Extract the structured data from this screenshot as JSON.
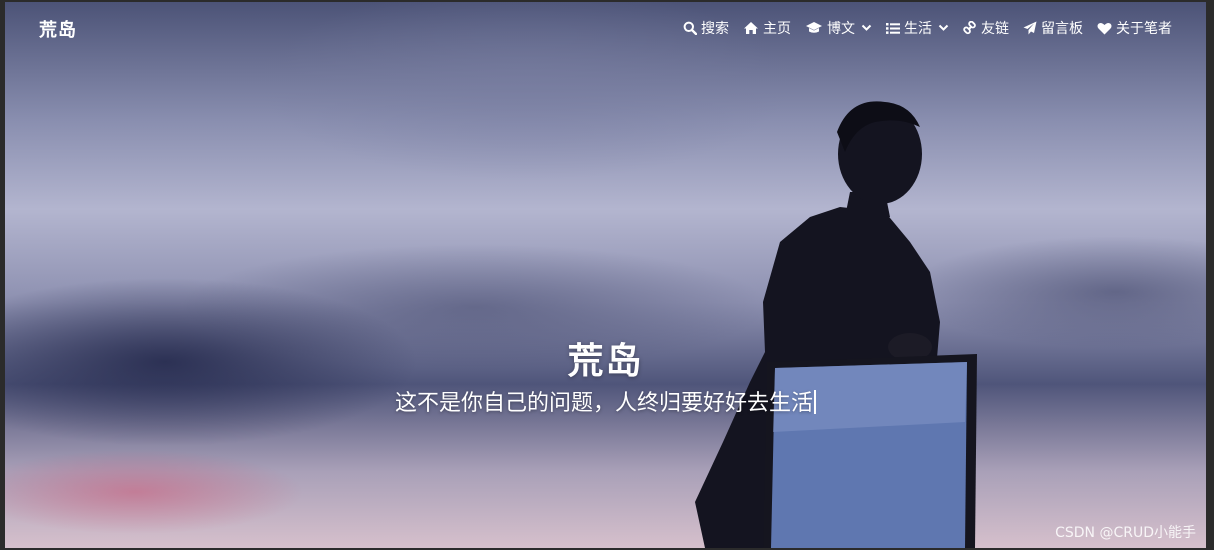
{
  "nav": {
    "brand": "荒岛",
    "items": [
      {
        "label": "搜索",
        "icon": "search-icon",
        "dropdown": false
      },
      {
        "label": "主页",
        "icon": "home-icon",
        "dropdown": false
      },
      {
        "label": "博文",
        "icon": "graduation-cap-icon",
        "dropdown": true
      },
      {
        "label": "生活",
        "icon": "list-icon",
        "dropdown": true
      },
      {
        "label": "友链",
        "icon": "link-icon",
        "dropdown": false
      },
      {
        "label": "留言板",
        "icon": "paper-plane-icon",
        "dropdown": false
      },
      {
        "label": "关于笔者",
        "icon": "heart-icon",
        "dropdown": false
      }
    ]
  },
  "hero": {
    "title": "荒岛",
    "subtitle": "这不是你自己的问题，人终归要好好去生活"
  },
  "watermark": "CSDN @CRUD小能手",
  "colors": {
    "text": "#ffffff",
    "sky_top": "#4c5377",
    "sky_mid": "#b3b5cf",
    "horizon_pink": "#d6c0cc",
    "silhouette": "#141420",
    "mirror": "#5f77b0"
  }
}
